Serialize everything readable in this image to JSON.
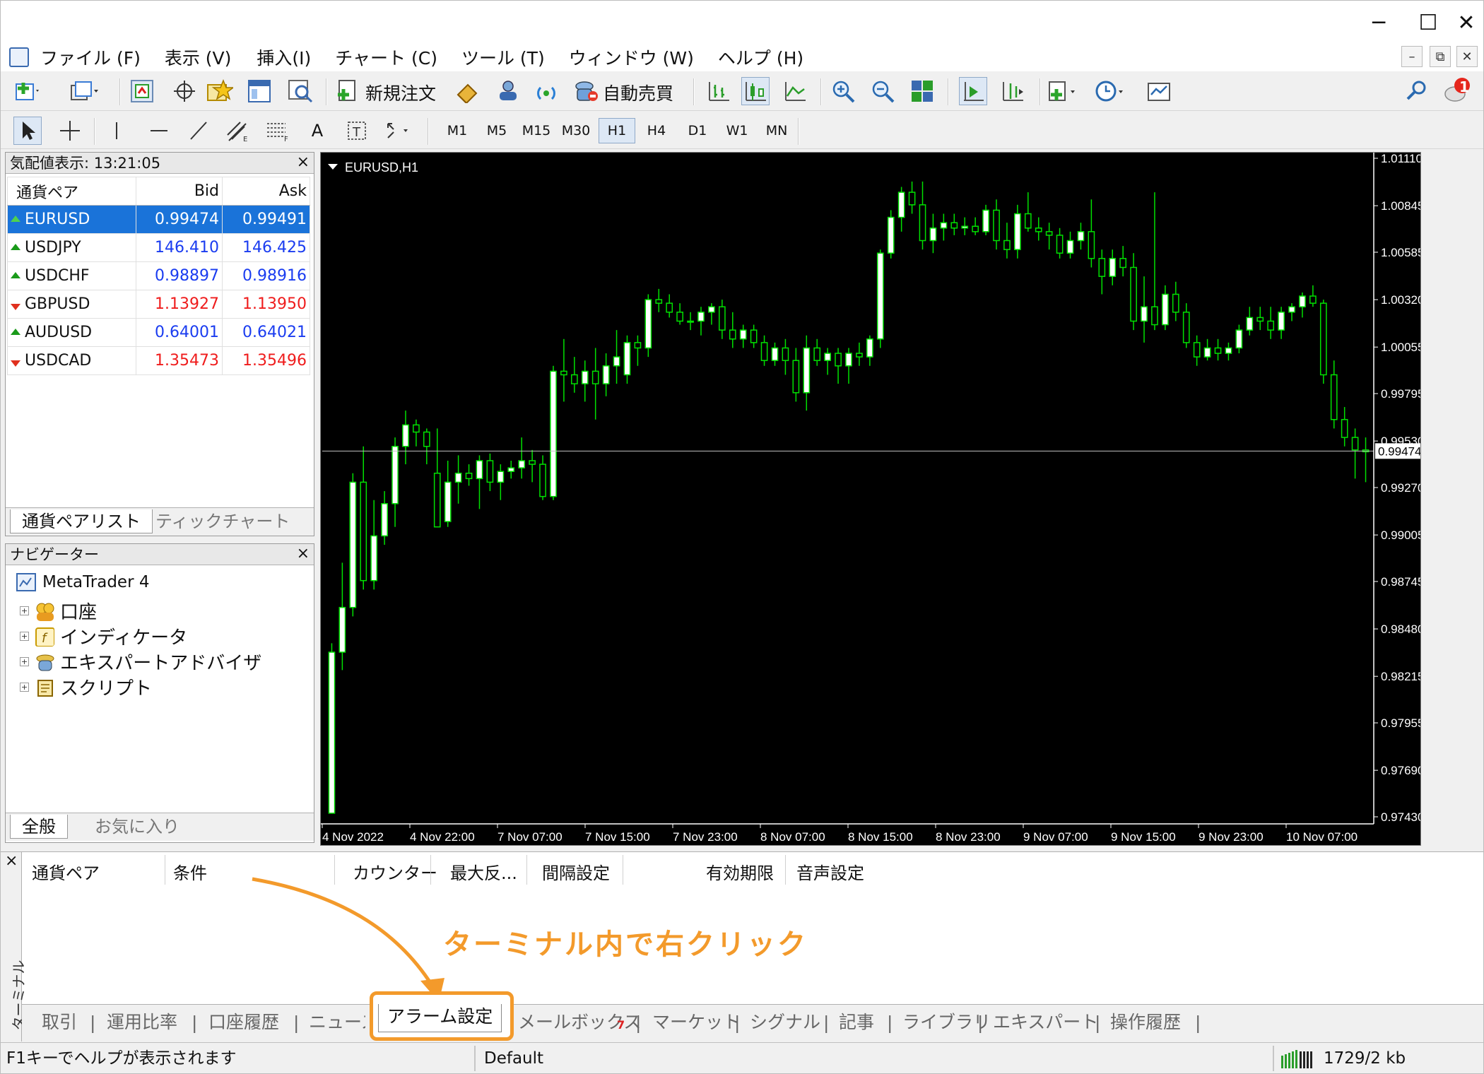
{
  "window": {
    "minimize": "─",
    "maximize": "☐",
    "close": "✕"
  },
  "menu": [
    "ファイル (F)",
    "表示 (V)",
    "挿入(I)",
    "チャート (C)",
    "ツール (T)",
    "ウィンドウ (W)",
    "ヘルプ (H)"
  ],
  "mdi": {
    "minimize": "–",
    "restore": "⧉",
    "close": "✕"
  },
  "toolbar": {
    "new_order": "新規注文",
    "auto_trading": "自動売買",
    "notification_count": "1"
  },
  "timeframes": [
    "M1",
    "M5",
    "M15",
    "M30",
    "H1",
    "H4",
    "D1",
    "W1",
    "MN"
  ],
  "active_timeframe": "H1",
  "market_watch": {
    "title": "気配値表示: 13:21:05",
    "close": "×",
    "headers": {
      "pair": "通貨ペア",
      "bid": "Bid",
      "ask": "Ask"
    },
    "rows": [
      {
        "symbol": "EURUSD",
        "bid": "0.99474",
        "ask": "0.99491",
        "dir": "up",
        "selected": true
      },
      {
        "symbol": "USDJPY",
        "bid": "146.410",
        "ask": "146.425",
        "dir": "up"
      },
      {
        "symbol": "USDCHF",
        "bid": "0.98897",
        "ask": "0.98916",
        "dir": "up"
      },
      {
        "symbol": "GBPUSD",
        "bid": "1.13927",
        "ask": "1.13950",
        "dir": "down"
      },
      {
        "symbol": "AUDUSD",
        "bid": "0.64001",
        "ask": "0.64021",
        "dir": "up"
      },
      {
        "symbol": "USDCAD",
        "bid": "1.35473",
        "ask": "1.35496",
        "dir": "down"
      }
    ],
    "tabs": [
      "通貨ペアリスト",
      "ティックチャート"
    ]
  },
  "navigator": {
    "title": "ナビゲーター",
    "close": "×",
    "root": "MetaTrader 4",
    "items": [
      "口座",
      "インディケータ",
      "エキスパートアドバイザ",
      "スクリプト"
    ],
    "tabs": [
      "全般",
      "お気に入り"
    ]
  },
  "chart": {
    "symbol_label": "EURUSD,H1",
    "current_price": "0.99474",
    "price_ticks": [
      "1.01110",
      "1.00845",
      "1.00585",
      "1.00320",
      "1.00055",
      "0.99795",
      "0.99530",
      "0.99270",
      "0.99005",
      "0.98745",
      "0.98480",
      "0.98215",
      "0.97955",
      "0.97690",
      "0.97430"
    ],
    "time_ticks": [
      "4 Nov 2022",
      "4 Nov 22:00",
      "7 Nov 07:00",
      "7 Nov 15:00",
      "7 Nov 23:00",
      "8 Nov 07:00",
      "8 Nov 15:00",
      "8 Nov 23:00",
      "9 Nov 07:00",
      "9 Nov 15:00",
      "9 Nov 23:00",
      "10 Nov 07:00"
    ],
    "colors": {
      "bg": "#000000",
      "bull_body": "#ffffff",
      "bear_body": "#000000",
      "wick": "#00e000"
    }
  },
  "chart_data": {
    "type": "candlestick",
    "symbol": "EURUSD",
    "timeframe": "H1",
    "ylim": [
      0.9743,
      1.0111
    ],
    "current_price": 0.99474,
    "candles": [
      [
        0.9745,
        0.984,
        0.9745,
        0.9835
      ],
      [
        0.9835,
        0.9885,
        0.9825,
        0.986
      ],
      [
        0.986,
        0.9935,
        0.9855,
        0.993
      ],
      [
        0.993,
        0.995,
        0.987,
        0.9875
      ],
      [
        0.9875,
        0.992,
        0.987,
        0.99
      ],
      [
        0.99,
        0.9925,
        0.9895,
        0.9918
      ],
      [
        0.9918,
        0.9955,
        0.9905,
        0.995
      ],
      [
        0.995,
        0.997,
        0.994,
        0.9962
      ],
      [
        0.9962,
        0.9965,
        0.995,
        0.9958
      ],
      [
        0.9958,
        0.996,
        0.994,
        0.995
      ],
      [
        0.9935,
        0.996,
        0.9905,
        0.9905
      ],
      [
        0.9908,
        0.9942,
        0.9905,
        0.993
      ],
      [
        0.993,
        0.9945,
        0.9918,
        0.9935
      ],
      [
        0.9935,
        0.994,
        0.9928,
        0.9932
      ],
      [
        0.9932,
        0.9945,
        0.9915,
        0.9942
      ],
      [
        0.9942,
        0.9946,
        0.9925,
        0.993
      ],
      [
        0.993,
        0.994,
        0.992,
        0.9936
      ],
      [
        0.9936,
        0.9942,
        0.9932,
        0.9938
      ],
      [
        0.9938,
        0.9955,
        0.9932,
        0.9942
      ],
      [
        0.9942,
        0.9948,
        0.993,
        0.994
      ],
      [
        0.994,
        0.9945,
        0.992,
        0.9922
      ],
      [
        0.9922,
        0.9995,
        0.992,
        0.9992
      ],
      [
        0.9992,
        1.001,
        0.9975,
        0.999
      ],
      [
        0.999,
        1.0,
        0.998,
        0.9985
      ],
      [
        0.9985,
        0.9998,
        0.9975,
        0.9992
      ],
      [
        0.9992,
        1.0005,
        0.9965,
        0.9985
      ],
      [
        0.9985,
        1.0002,
        0.9978,
        0.9995
      ],
      [
        0.9995,
        1.0015,
        0.9985,
        1.0
      ],
      [
        0.999,
        1.0012,
        0.9985,
        1.0008
      ],
      [
        1.0008,
        1.0012,
        0.9995,
        1.0005
      ],
      [
        1.0005,
        1.0035,
        1.0,
        1.0032
      ],
      [
        1.0032,
        1.0038,
        1.0025,
        1.003
      ],
      [
        1.003,
        1.0035,
        1.0022,
        1.0025
      ],
      [
        1.0025,
        1.003,
        1.0018,
        1.002
      ],
      [
        1.002,
        1.0025,
        1.0015,
        1.002
      ],
      [
        1.002,
        1.0028,
        1.0012,
        1.0025
      ],
      [
        1.0025,
        1.003,
        1.0018,
        1.0028
      ],
      [
        1.0028,
        1.0032,
        1.001,
        1.0015
      ],
      [
        1.0015,
        1.0025,
        1.0005,
        1.001
      ],
      [
        1.001,
        1.0018,
        1.0005,
        1.0015
      ],
      [
        1.0015,
        1.0018,
        1.0005,
        1.0008
      ],
      [
        1.0008,
        1.0012,
        0.9995,
        0.9998
      ],
      [
        0.9998,
        1.0008,
        0.9995,
        1.0005
      ],
      [
        1.0005,
        1.001,
        0.999,
        0.9998
      ],
      [
        0.9998,
        1.0005,
        0.9975,
        0.998
      ],
      [
        0.998,
        1.0012,
        0.997,
        1.0005
      ],
      [
        1.0005,
        1.001,
        0.9995,
        0.9998
      ],
      [
        0.9998,
        1.0005,
        0.999,
        1.0002
      ],
      [
        1.0002,
        1.0005,
        0.9985,
        0.9995
      ],
      [
        0.9995,
        1.0005,
        0.9985,
        1.0002
      ],
      [
        1.0002,
        1.0008,
        0.9995,
        1.0
      ],
      [
        1.0,
        1.0012,
        0.9995,
        1.001
      ],
      [
        1.001,
        1.006,
        1.0005,
        1.0058
      ],
      [
        1.0058,
        1.0082,
        1.0055,
        1.0078
      ],
      [
        1.0078,
        1.0095,
        1.007,
        1.0092
      ],
      [
        1.0092,
        1.0098,
        1.008,
        1.0085
      ],
      [
        1.0085,
        1.0098,
        1.006,
        1.0065
      ],
      [
        1.0065,
        1.008,
        1.0058,
        1.0072
      ],
      [
        1.0072,
        1.008,
        1.0065,
        1.0075
      ],
      [
        1.0075,
        1.008,
        1.0068,
        1.0072
      ],
      [
        1.0072,
        1.0078,
        1.0068,
        1.0073
      ],
      [
        1.0073,
        1.0078,
        1.0068,
        1.007
      ],
      [
        1.007,
        1.0085,
        1.0068,
        1.0082
      ],
      [
        1.0082,
        1.0088,
        1.006,
        1.0065
      ],
      [
        1.0065,
        1.0075,
        1.0055,
        1.006
      ],
      [
        1.006,
        1.0085,
        1.0055,
        1.008
      ],
      [
        1.008,
        1.0092,
        1.007,
        1.0072
      ],
      [
        1.0072,
        1.0078,
        1.0065,
        1.007
      ],
      [
        1.007,
        1.0075,
        1.006,
        1.0068
      ],
      [
        1.0068,
        1.0072,
        1.0055,
        1.0058
      ],
      [
        1.0058,
        1.007,
        1.0055,
        1.0065
      ],
      [
        1.0065,
        1.0075,
        1.006,
        1.007
      ],
      [
        1.007,
        1.0088,
        1.005,
        1.0055
      ],
      [
        1.0055,
        1.006,
        1.0035,
        1.0045
      ],
      [
        1.0045,
        1.006,
        1.004,
        1.0055
      ],
      [
        1.0055,
        1.0062,
        1.0045,
        1.005
      ],
      [
        1.005,
        1.0058,
        1.0015,
        1.002
      ],
      [
        1.002,
        1.0045,
        1.0008,
        1.0028
      ],
      [
        1.0028,
        1.0092,
        1.0015,
        1.0018
      ],
      [
        1.0018,
        1.004,
        1.0015,
        1.0035
      ],
      [
        1.0035,
        1.0042,
        1.002,
        1.0025
      ],
      [
        1.0025,
        1.003,
        1.0005,
        1.0008
      ],
      [
        1.0008,
        1.0012,
        0.9995,
        1.0
      ],
      [
        1.0,
        1.001,
        0.9998,
        1.0005
      ],
      [
        1.0005,
        1.001,
        0.9998,
        1.0002
      ],
      [
        1.0002,
        1.0008,
        0.9998,
        1.0005
      ],
      [
        1.0005,
        1.0018,
        1.0002,
        1.0015
      ],
      [
        1.0015,
        1.0028,
        1.0012,
        1.0022
      ],
      [
        1.0022,
        1.0028,
        1.0015,
        1.002
      ],
      [
        1.002,
        1.0028,
        1.001,
        1.0015
      ],
      [
        1.0015,
        1.0028,
        1.001,
        1.0025
      ],
      [
        1.0025,
        1.003,
        1.002,
        1.0028
      ],
      [
        1.0028,
        1.0036,
        1.0022,
        1.0034
      ],
      [
        1.0034,
        1.004,
        1.0028,
        1.003
      ],
      [
        1.003,
        1.0032,
        0.9985,
        0.999
      ],
      [
        0.999,
        0.9998,
        0.996,
        0.9965
      ],
      [
        0.9965,
        0.9972,
        0.995,
        0.9955
      ],
      [
        0.9955,
        0.996,
        0.9932,
        0.9948
      ],
      [
        0.9948,
        0.9955,
        0.993,
        0.9947
      ]
    ]
  },
  "terminal": {
    "close": "×",
    "side_label": "ターミナル",
    "columns": [
      "通貨ペア",
      "条件",
      "カウンター",
      "最大反...",
      "間隔設定",
      "有効期限",
      "音声設定"
    ],
    "annotation": "ターミナル内で右クリック",
    "annotation_color": "#f39a2b",
    "tabs": [
      "取引",
      "運用比率",
      "口座履歴",
      "ニュース",
      "アラーム設定",
      "メールボックス",
      "マーケット",
      "シグナル",
      "記事",
      "ライブラリ",
      "エキスパート",
      "操作履歴"
    ],
    "mailbox_badge": "7",
    "active_tab": "アラーム設定"
  },
  "status": {
    "help": "F1キーでヘルプが表示されます",
    "profile": "Default",
    "traffic": "1729/2 kb"
  }
}
